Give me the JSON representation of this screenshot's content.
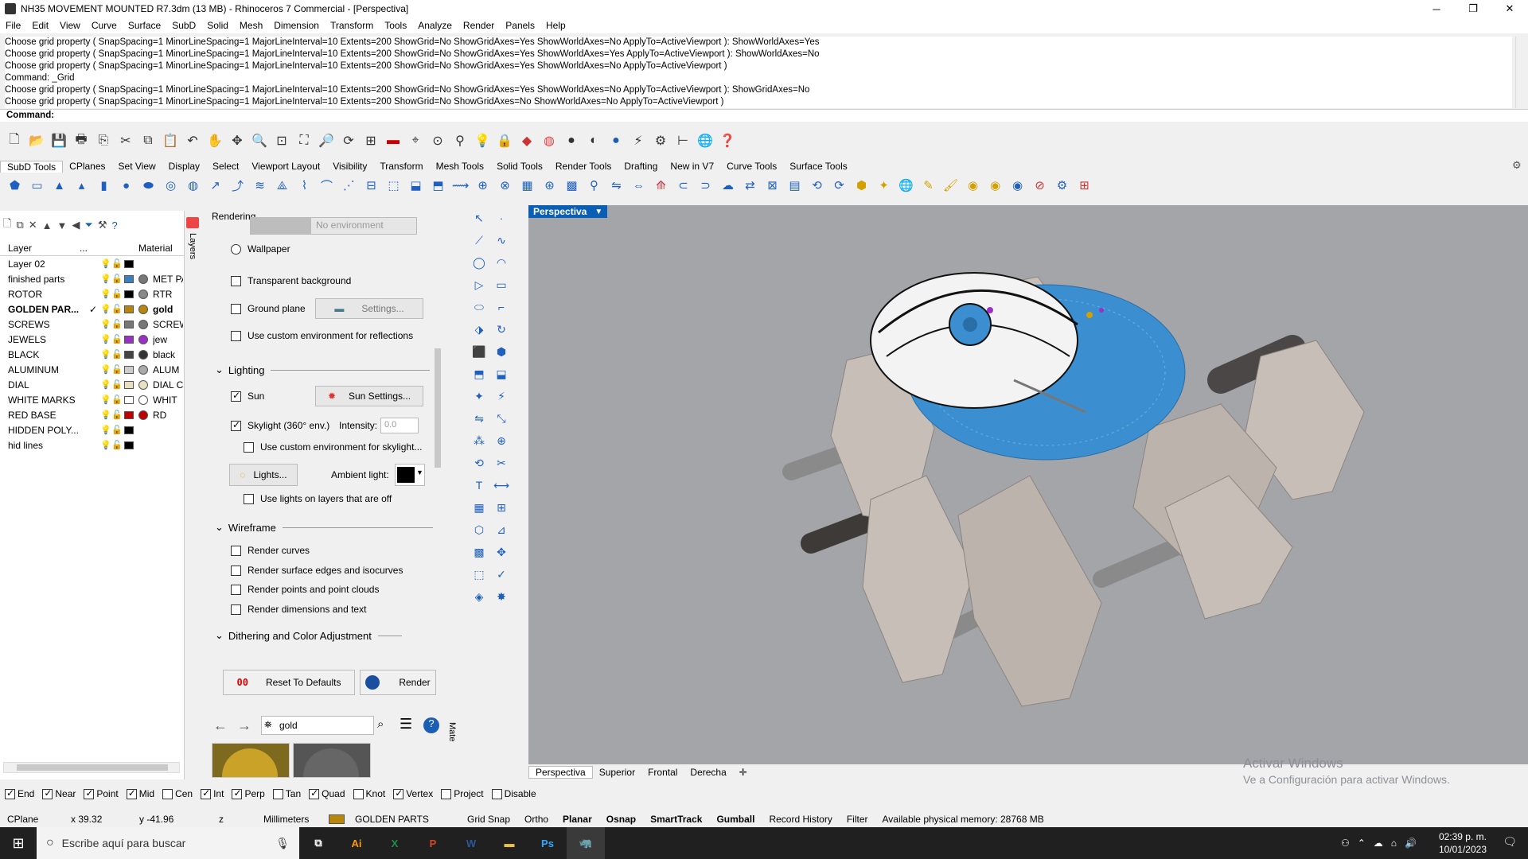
{
  "window": {
    "title": "NH35 MOVEMENT MOUNTED R7.3dm (13 MB) - Rhinoceros 7 Commercial - [Perspectiva]"
  },
  "menu": [
    "File",
    "Edit",
    "View",
    "Curve",
    "Surface",
    "SubD",
    "Solid",
    "Mesh",
    "Dimension",
    "Transform",
    "Tools",
    "Analyze",
    "Render",
    "Panels",
    "Help"
  ],
  "command_history": [
    "Choose grid property ( SnapSpacing=1  MinorLineSpacing=1  MajorLineInterval=10  Extents=200  ShowGrid=No  ShowGridAxes=Yes  ShowWorldAxes=No  ApplyTo=ActiveViewport ): ShowWorldAxes=Yes",
    "Choose grid property ( SnapSpacing=1  MinorLineSpacing=1  MajorLineInterval=10  Extents=200  ShowGrid=No  ShowGridAxes=Yes  ShowWorldAxes=Yes  ApplyTo=ActiveViewport ): ShowWorldAxes=No",
    "Choose grid property ( SnapSpacing=1  MinorLineSpacing=1  MajorLineInterval=10  Extents=200  ShowGrid=No  ShowGridAxes=Yes  ShowWorldAxes=No  ApplyTo=ActiveViewport )",
    "Command: _Grid",
    "Choose grid property ( SnapSpacing=1  MinorLineSpacing=1  MajorLineInterval=10  Extents=200  ShowGrid=No  ShowGridAxes=Yes  ShowWorldAxes=No  ApplyTo=ActiveViewport ): ShowGridAxes=No",
    "Choose grid property ( SnapSpacing=1  MinorLineSpacing=1  MajorLineInterval=10  Extents=200  ShowGrid=No  ShowGridAxes=No  ShowWorldAxes=No  ApplyTo=ActiveViewport )"
  ],
  "command_prompt": "Command:",
  "toolbar_tabs": [
    "SubD Tools",
    "CPlanes",
    "Set View",
    "Display",
    "Select",
    "Viewport Layout",
    "Visibility",
    "Transform",
    "Mesh Tools",
    "Solid Tools",
    "Render Tools",
    "Drafting",
    "New in V7",
    "Curve Tools",
    "Surface Tools"
  ],
  "layers": {
    "header": {
      "layer": "Layer",
      "dots": "...",
      "material": "Material"
    },
    "rows": [
      {
        "name": "Layer 02",
        "color": "#000000",
        "material": "",
        "matcolor": ""
      },
      {
        "name": "finished parts",
        "color": "#3a7fc1",
        "material": "MET PA",
        "matcolor": "#777777"
      },
      {
        "name": "ROTOR",
        "color": "#000000",
        "material": "RTR",
        "matcolor": "#888888"
      },
      {
        "name": "GOLDEN PAR...",
        "color": "#b8860b",
        "material": "gold",
        "matcolor": "#b8860b",
        "current": "✓"
      },
      {
        "name": "SCREWS",
        "color": "#777777",
        "material": "SCREW",
        "matcolor": "#777777"
      },
      {
        "name": "JEWELS",
        "color": "#9b30c8",
        "material": "jew",
        "matcolor": "#9b30c8"
      },
      {
        "name": "BLACK",
        "color": "#444444",
        "material": "black",
        "matcolor": "#333333"
      },
      {
        "name": "ALUMINUM",
        "color": "#cccccc",
        "material": "ALUM",
        "matcolor": "#aaaaaa"
      },
      {
        "name": "DIAL",
        "color": "#e8e0c0",
        "material": "DIAL C",
        "matcolor": "#e8e0c0"
      },
      {
        "name": "WHITE MARKS",
        "color": "#ffffff",
        "material": "WHIT",
        "matcolor": "#ffffff"
      },
      {
        "name": "RED BASE",
        "color": "#c00000",
        "material": "RD",
        "matcolor": "#c00000"
      },
      {
        "name": "HIDDEN POLY...",
        "color": "#000000",
        "material": "",
        "matcolor": ""
      },
      {
        "name": "hid lines",
        "color": "#000000",
        "material": "",
        "matcolor": ""
      }
    ]
  },
  "side_tab": "Layers",
  "rendering": {
    "title": "Rendering",
    "env_placeholder": "No environment",
    "wallpaper": "Wallpaper",
    "transparent_bg": "Transparent background",
    "ground_plane": "Ground plane",
    "settings_btn": "Settings...",
    "custom_env_refl": "Use custom environment for reflections",
    "lighting_hdr": "Lighting",
    "sun": "Sun",
    "sun_settings": "Sun Settings...",
    "skylight": "Skylight (360° env.)",
    "intensity_label": "Intensity:",
    "intensity_value": "0.0",
    "custom_env_sky": "Use custom environment for skylight...",
    "lights_btn": "Lights...",
    "ambient_label": "Ambient light:",
    "lights_off_layers": "Use lights on layers that are off",
    "wireframe_hdr": "Wireframe",
    "render_curves": "Render curves",
    "render_edges": "Render surface edges and isocurves",
    "render_points": "Render points and point clouds",
    "render_dims": "Render dimensions and text",
    "dither_hdr": "Dithering and Color Adjustment",
    "reset_btn": "Reset To Defaults",
    "render_btn": "Render"
  },
  "material_browser": {
    "search_value": "gold",
    "side_label": "Mate"
  },
  "viewport": {
    "label": "Perspectiva",
    "watermark1": "Activar Windows",
    "watermark2": "Ve a Configuración para activar Windows."
  },
  "view_tabs": [
    "Perspectiva",
    "Superior",
    "Frontal",
    "Derecha"
  ],
  "osnaps": [
    {
      "label": "End",
      "on": true
    },
    {
      "label": "Near",
      "on": true
    },
    {
      "label": "Point",
      "on": true
    },
    {
      "label": "Mid",
      "on": true
    },
    {
      "label": "Cen",
      "on": false
    },
    {
      "label": "Int",
      "on": true
    },
    {
      "label": "Perp",
      "on": true
    },
    {
      "label": "Tan",
      "on": false
    },
    {
      "label": "Quad",
      "on": true
    },
    {
      "label": "Knot",
      "on": false
    },
    {
      "label": "Vertex",
      "on": true
    },
    {
      "label": "Project",
      "on": false
    },
    {
      "label": "Disable",
      "on": false
    }
  ],
  "status": {
    "cplane": "CPlane",
    "x": "x 39.32",
    "y": "y -41.96",
    "z": "z",
    "units": "Millimeters",
    "layer": "GOLDEN PARTS",
    "grid_snap": "Grid Snap",
    "ortho": "Ortho",
    "planar": "Planar",
    "osnap": "Osnap",
    "smarttrack": "SmartTrack",
    "gumball": "Gumball",
    "record_history": "Record History",
    "filter": "Filter",
    "memory": "Available physical memory: 28768 MB"
  },
  "taskbar": {
    "search_placeholder": "Escribe aquí para buscar",
    "time": "02:39 p. m.",
    "date": "10/01/2023"
  }
}
